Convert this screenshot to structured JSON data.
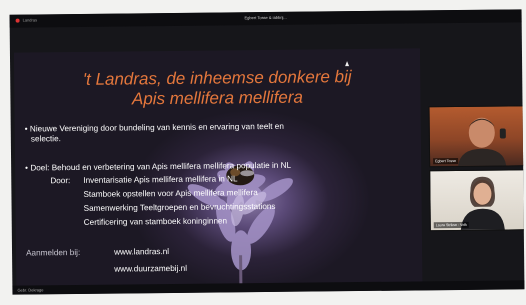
{
  "window": {
    "app_label": "Landras",
    "title": "Egbert Tosse & iabbrij..."
  },
  "slide": {
    "title_line1": "'t Landras, de inheemse donkere bij",
    "title_line2": "Apis mellifera mellifera",
    "bullet1_line1": "• Nieuwe Vereniging door bundeling van kennis en ervaring van teelt en",
    "bullet1_line2": "selectie.",
    "bullet2": "• Doel: Behoud en verbetering van Apis mellifera mellifera populatie in NL",
    "door_label": "Door:",
    "door_items": [
      "Inventarisatie Apis mellifera mellifera in NL",
      "Stamboek opstellen voor Apis mellifera mellifera",
      "Samenwerking Teeltgroepen en bevruchtingsstations",
      "Certificering van stamboek koninginnen"
    ],
    "aanmelden_label": "Aanmelden bij:",
    "links": [
      "www.landras.nl",
      "www.duurzamebij.nl"
    ]
  },
  "participants": [
    {
      "name": "Egbert Tosse"
    },
    {
      "name": "Laura Strikse - Volk"
    }
  ],
  "bottombar": {
    "user": "Gebr. Dekrage"
  },
  "colors": {
    "title": "#e4773c",
    "text": "#ffffff",
    "background": "#1c1824"
  }
}
